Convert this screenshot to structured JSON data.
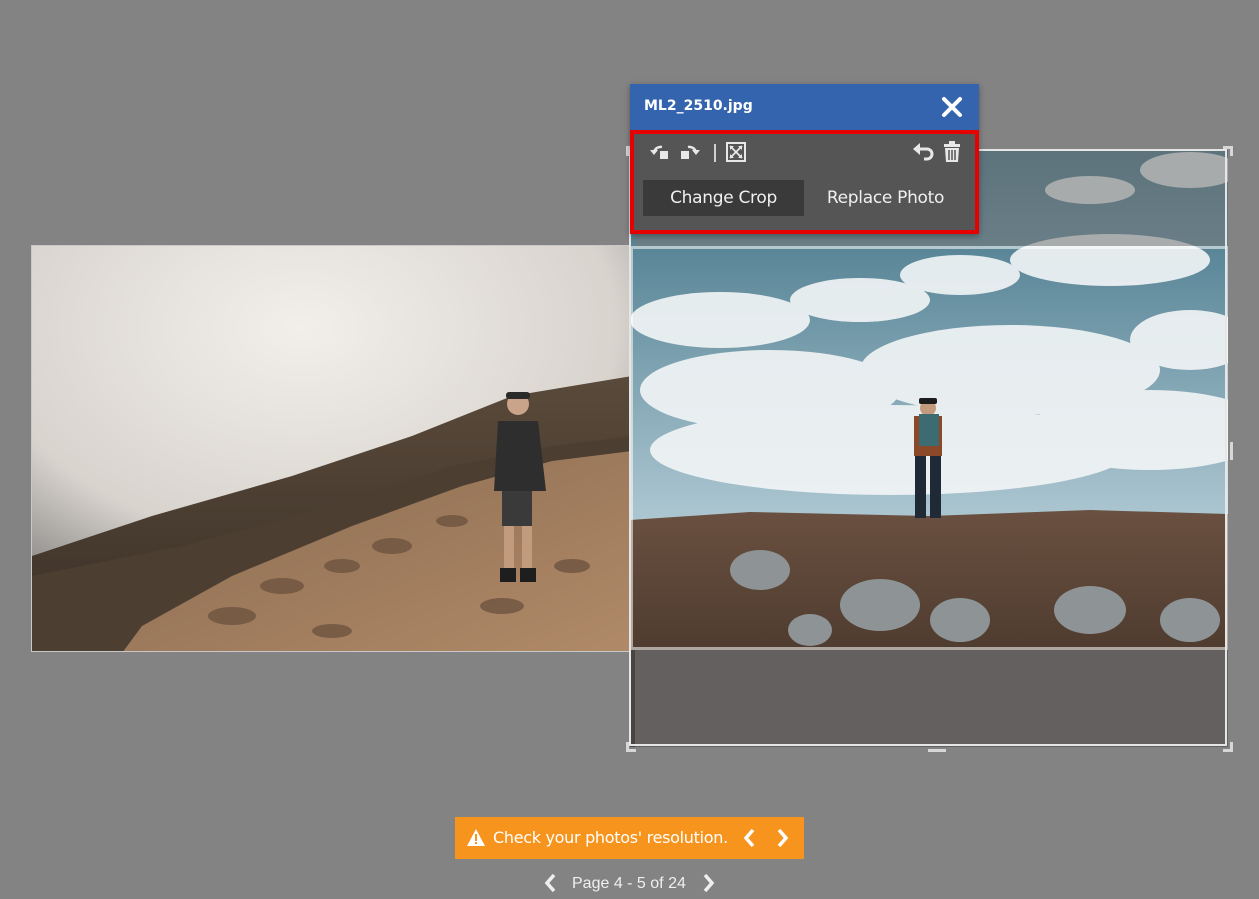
{
  "editor": {
    "filename": "ML2_2510.jpg",
    "close_icon": "close-icon",
    "toolbar": {
      "rotate_left_icon": "rotate-left-icon",
      "rotate_right_icon": "rotate-right-icon",
      "fit_icon": "fit-to-frame-icon",
      "undo_icon": "undo-icon",
      "delete_icon": "trash-icon"
    },
    "tabs": [
      {
        "label": "Change Crop",
        "active": true
      },
      {
        "label": "Replace Photo",
        "active": false
      }
    ]
  },
  "warning": {
    "text": "Check your photos' resolution.",
    "icon": "warning-icon"
  },
  "pager": {
    "label": "Page 4 - 5 of 24"
  },
  "colors": {
    "background": "#838383",
    "editor_header": "#3464ad",
    "editor_body": "#555555",
    "highlight": "#e60000",
    "warning": "#f7941d"
  }
}
